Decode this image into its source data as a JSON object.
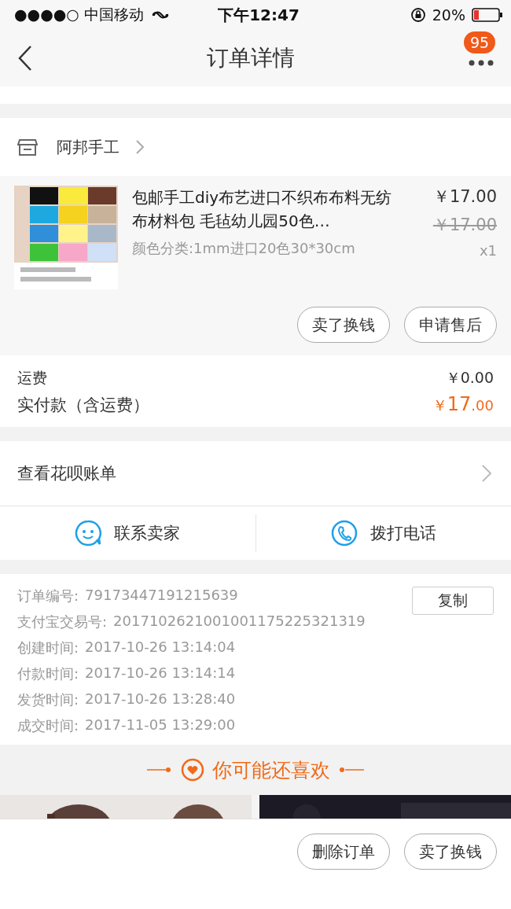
{
  "status_bar": {
    "carrier": "●●●●○ 中国移动",
    "time": "下午12:47",
    "battery": "20%"
  },
  "header": {
    "title": "订单详情",
    "badge": "95"
  },
  "shop": {
    "name": "阿邦手工"
  },
  "product": {
    "title": "包邮手工diy布艺进口不织布布料无纺布材料包 毛毡幼儿园50色…",
    "variant": "颜色分类:1mm进口20色30*30cm",
    "price": "￥17.00",
    "original_price": "￥17.00",
    "quantity": "x1",
    "buttons": [
      "卖了换钱",
      "申请售后"
    ]
  },
  "costs": {
    "shipping_label": "运费",
    "shipping": "￥0.00",
    "paid_label": "实付款（含运费）",
    "paid_currency": "￥",
    "paid_int": "17",
    "paid_dec": ".00"
  },
  "huabei": {
    "label": "查看花呗账单"
  },
  "contact": [
    {
      "kind": "chat",
      "label": "联系卖家"
    },
    {
      "kind": "phone",
      "label": "拨打电话"
    }
  ],
  "order_info": {
    "copy_button": "复制",
    "rows": [
      {
        "label": "订单编号:",
        "value": "79173447191215639"
      },
      {
        "label": "支付宝交易号:",
        "value": "2017102621001001175225321319"
      },
      {
        "label": "创建时间:",
        "value": "2017-10-26 13:14:04"
      },
      {
        "label": "付款时间:",
        "value": "2017-10-26 13:14:14"
      },
      {
        "label": "发货时间:",
        "value": "2017-10-26 13:28:40"
      },
      {
        "label": "成交时间:",
        "value": "2017-11-05 13:29:00"
      }
    ]
  },
  "recommend": {
    "title": "你可能还喜欢"
  },
  "bottom_bar": {
    "buttons": [
      "删除订单",
      "卖了换钱"
    ]
  }
}
